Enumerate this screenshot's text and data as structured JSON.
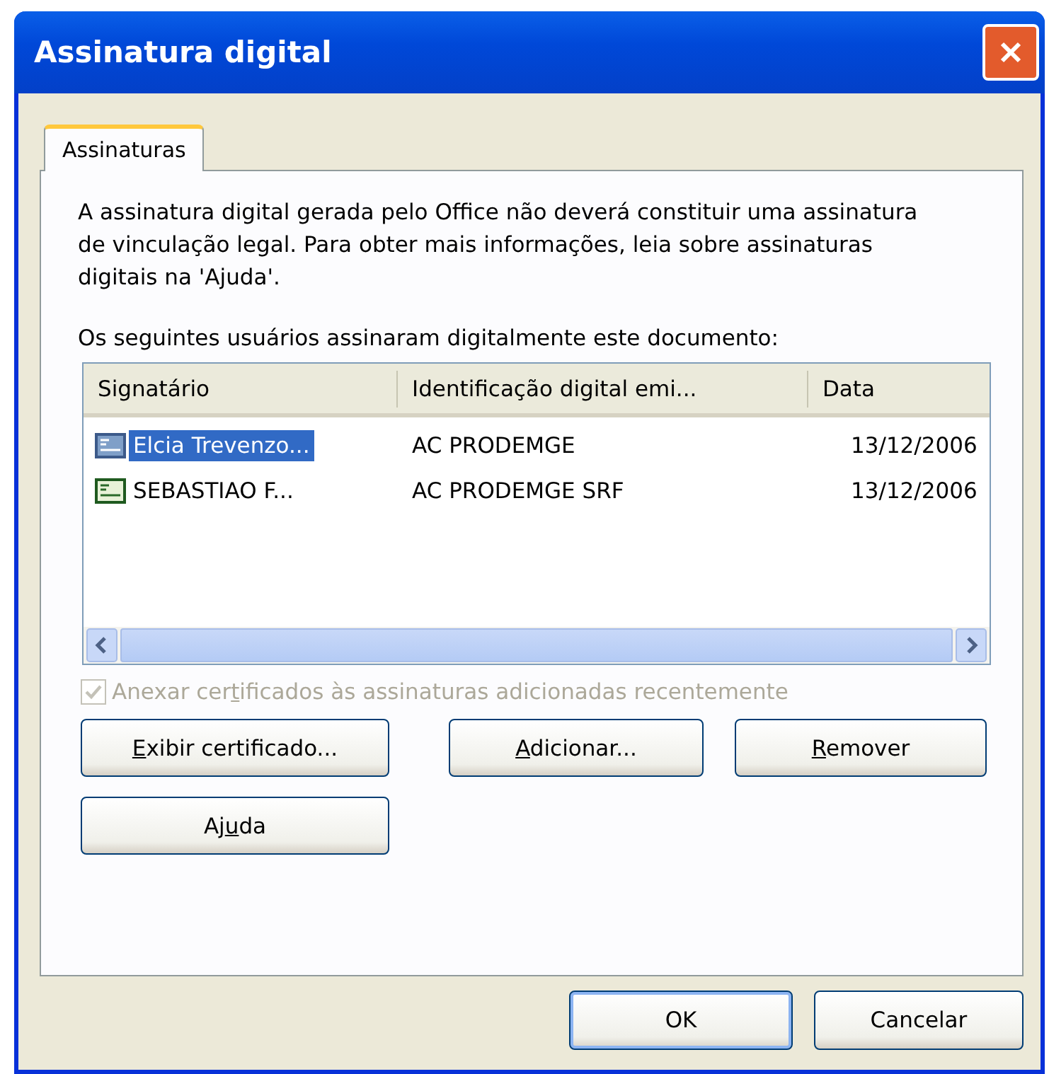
{
  "window": {
    "title": "Assinatura digital"
  },
  "tabs": [
    {
      "label": "Assinaturas",
      "selected": true
    }
  ],
  "notice": "A assinatura digital gerada pelo Office não deverá constituir uma assinatura de vinculação legal. Para obter mais informações, leia sobre assinaturas digitais na 'Ajuda'.",
  "list_label": "Os seguintes usuários assinaram digitalmente este documento:",
  "table": {
    "columns": [
      "Signatário",
      "Identificação digital emi...",
      "Data"
    ],
    "rows": [
      {
        "cells": [
          "Elcia Trevenzo...",
          "AC PRODEMGE",
          "13/12/2006"
        ],
        "selected": true
      },
      {
        "cells": [
          "SEBASTIAO F...",
          "AC PRODEMGE SRF",
          "13/12/2006"
        ],
        "selected": false
      }
    ]
  },
  "checkbox": {
    "before": "Anexar cer",
    "key": "t",
    "after": "ificados às assinaturas adicionadas recentemente",
    "checked": true,
    "disabled": true
  },
  "buttons": [
    {
      "key": "E",
      "after": "xibir certificado..."
    },
    {
      "key": "A",
      "after": "dicionar..."
    },
    {
      "key": "R",
      "after": "emover"
    },
    {
      "before": "Aj",
      "key": "u",
      "after": "da"
    }
  ],
  "footer_buttons": [
    {
      "label": "OK",
      "default": true
    },
    {
      "label": "Cancelar",
      "default": false
    }
  ]
}
